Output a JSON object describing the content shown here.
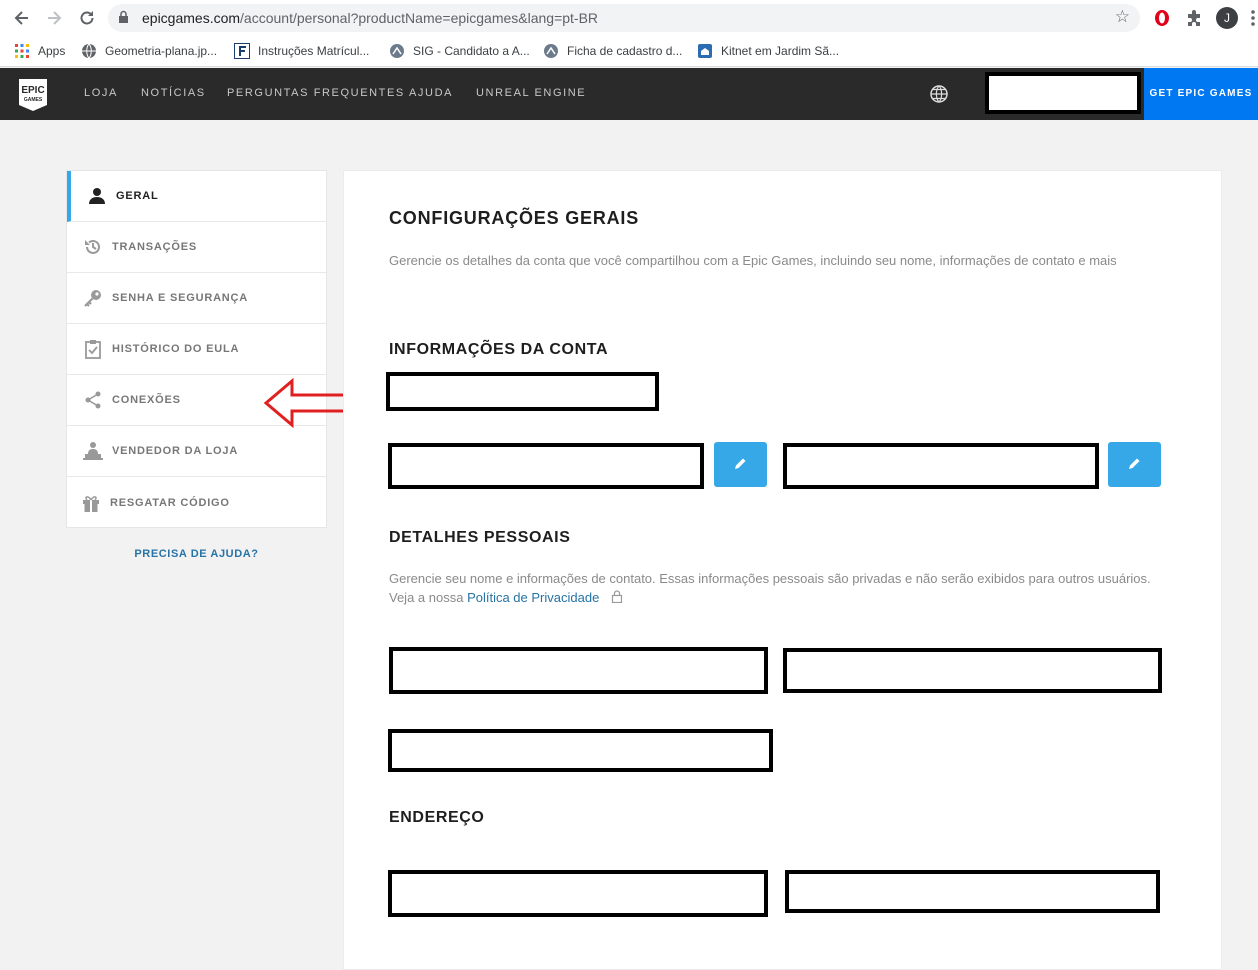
{
  "browser": {
    "url_host": "epicgames.com",
    "url_path": "/account/personal?productName=epicgames&lang=pt-BR",
    "avatar_initial": "J",
    "bookmarks": [
      {
        "label": "Apps",
        "icon": "apps-grid-icon"
      },
      {
        "label": "Geometria-plana.jp...",
        "icon": "globe-favicon-icon"
      },
      {
        "label": "Instruções Matrícul...",
        "icon": "f-favicon-icon"
      },
      {
        "label": "SIG - Candidato a A...",
        "icon": "sig-favicon-icon"
      },
      {
        "label": "Ficha de cadastro d...",
        "icon": "sig-favicon-icon"
      },
      {
        "label": "Kitnet em Jardim Sã...",
        "icon": "home-favicon-icon"
      }
    ]
  },
  "nav": {
    "links": [
      "LOJA",
      "NOTÍCIAS",
      "PERGUNTAS FREQUENTES",
      "AJUDA",
      "UNREAL ENGINE"
    ],
    "get_epic": "GET EPIC GAMES"
  },
  "sidebar": {
    "items": [
      {
        "label": "GERAL",
        "icon": "person-icon",
        "active": true
      },
      {
        "label": "TRANSAÇÕES",
        "icon": "history-icon",
        "active": false
      },
      {
        "label": "SENHA E SEGURANÇA",
        "icon": "key-icon",
        "active": false
      },
      {
        "label": "HISTÓRICO DO EULA",
        "icon": "clipboard-check-icon",
        "active": false
      },
      {
        "label": "CONEXÕES",
        "icon": "share-icon",
        "active": false
      },
      {
        "label": "VENDEDOR DA LOJA",
        "icon": "vendor-icon",
        "active": false
      },
      {
        "label": "RESGATAR CÓDIGO",
        "icon": "gift-icon",
        "active": false
      }
    ],
    "help": "PRECISA DE AJUDA?"
  },
  "main": {
    "title": "CONFIGURAÇÕES GERAIS",
    "subtitle": "Gerencie os detalhes da conta que você compartilhou com a Epic Games, incluindo seu nome, informações de contato e mais",
    "account_heading": "INFORMAÇÕES DA CONTA",
    "personal_heading": "DETALHES PESSOAIS",
    "personal_desc": "Gerencie seu nome e informações de contato. Essas informações pessoais são privadas e não serão exibidos para outros usuários. Veja a nossa ",
    "privacy_link": "Política de Privacidade",
    "address_heading": "ENDEREÇO"
  },
  "colors": {
    "accent": "#37a8e7",
    "nav_bg": "#2a2a2a",
    "get_epic_bg": "#0078f2",
    "annotation_arrow": "#e02020"
  }
}
